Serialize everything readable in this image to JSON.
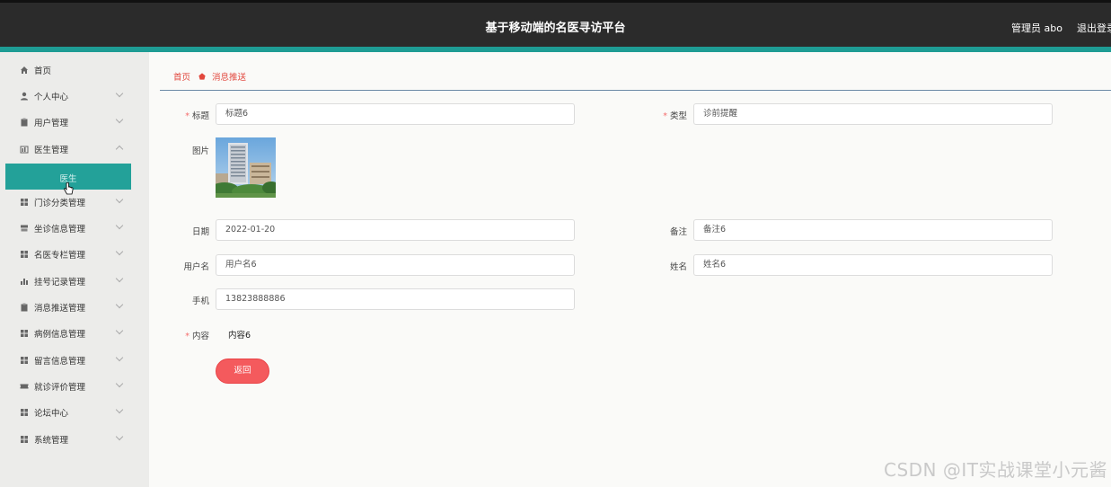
{
  "header": {
    "title": "基于移动端的名医寻访平台",
    "admin": "管理员 abo",
    "logout": "退出登录"
  },
  "sidebar": {
    "items": [
      {
        "label": "首页",
        "icon": "home-icon"
      },
      {
        "label": "个人中心",
        "icon": "user-icon"
      },
      {
        "label": "用户管理",
        "icon": "clipboard-icon"
      },
      {
        "label": "医生管理",
        "icon": "bar-icon"
      },
      {
        "label": "门诊分类管理",
        "icon": "grid-icon"
      },
      {
        "label": "坐诊信息管理",
        "icon": "stack-icon"
      },
      {
        "label": "名医专栏管理",
        "icon": "grid-icon"
      },
      {
        "label": "挂号记录管理",
        "icon": "chart-icon"
      },
      {
        "label": "消息推送管理",
        "icon": "clipboard-icon"
      },
      {
        "label": "病例信息管理",
        "icon": "grid-icon"
      },
      {
        "label": "留言信息管理",
        "icon": "grid-icon"
      },
      {
        "label": "就诊评价管理",
        "icon": "ticket-icon"
      },
      {
        "label": "论坛中心",
        "icon": "grid-icon"
      },
      {
        "label": "系统管理",
        "icon": "grid-icon"
      }
    ],
    "active_sub": "医生"
  },
  "breadcrumb": {
    "home": "首页",
    "current": "消息推送"
  },
  "form": {
    "title_label": "标题",
    "title_value": "标题6",
    "type_label": "类型",
    "type_value": "诊前提醒",
    "image_label": "图片",
    "date_label": "日期",
    "date_value": "2022-01-20",
    "remark_label": "备注",
    "remark_value": "备注6",
    "username_label": "用户名",
    "username_value": "用户名6",
    "name_label": "姓名",
    "name_value": "姓名6",
    "phone_label": "手机",
    "phone_value": "13823888886",
    "content_label": "内容",
    "content_value": "内容6",
    "back_button": "返回"
  },
  "watermark": "CSDN @IT实战课堂小元酱",
  "colors": {
    "header_bg": "#2b2b2b",
    "accent": "#1e9c94",
    "active_sub_bg": "#23a199",
    "breadcrumb": "#e2473d",
    "back_button": "#f45a5d"
  }
}
